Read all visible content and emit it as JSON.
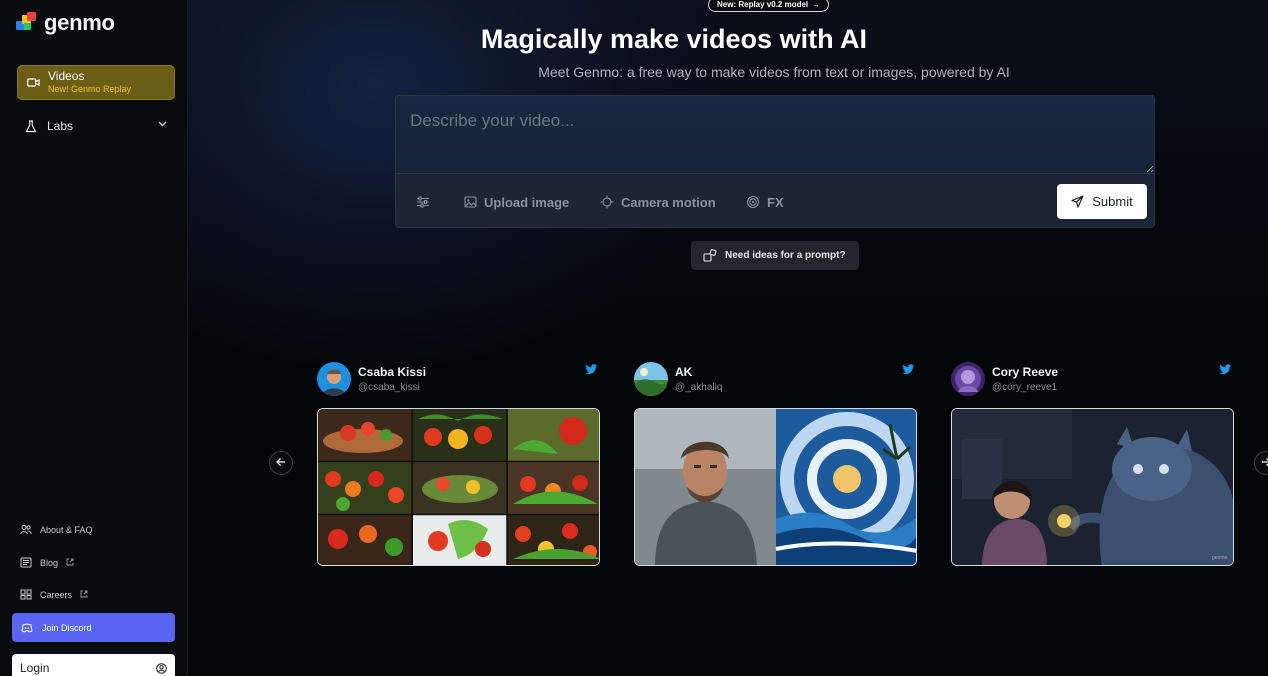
{
  "sidebar": {
    "logo_text": "genmo",
    "videos": {
      "label": "Videos",
      "sub": "New! Genmo Replay"
    },
    "labs": {
      "label": "Labs"
    },
    "links": {
      "about": "About & FAQ",
      "blog": "Blog",
      "careers": "Careers"
    },
    "discord": "Join Discord",
    "login": "Login"
  },
  "announcement": "New: Replay v0.2 model",
  "hero": {
    "title": "Magically make videos with AI",
    "subtitle": "Meet Genmo: a free way to make videos from text or images, powered by AI"
  },
  "prompt": {
    "placeholder": "Describe your video...",
    "upload": "Upload image",
    "camera": "Camera motion",
    "fx": "FX",
    "submit": "Submit"
  },
  "ideas_label": "Need ideas for a prompt?",
  "cards": [
    {
      "name": "Csaba Kissi",
      "handle": "@csaba_kissi"
    },
    {
      "name": "AK",
      "handle": "@_akhaliq"
    },
    {
      "name": "Cory Reeve",
      "handle": "@cory_reeve1"
    }
  ],
  "colors": {
    "accent_videos": "#6b5e14",
    "discord": "#5865f2",
    "twitter": "#1d9bf0"
  }
}
